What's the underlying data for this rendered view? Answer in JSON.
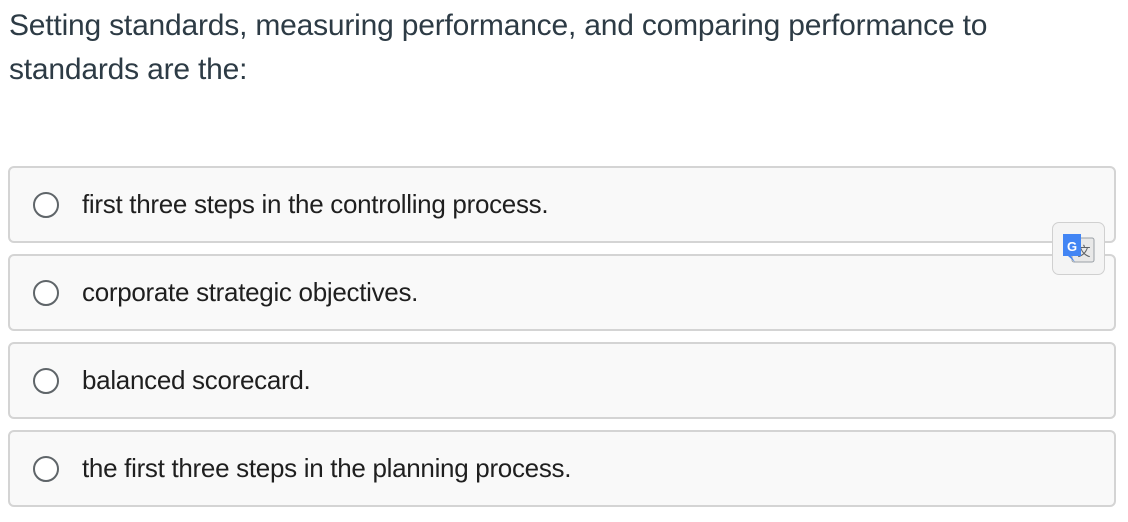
{
  "question": {
    "text": "Setting standards, measuring performance, and comparing performance to standards are the:"
  },
  "answers": [
    {
      "label": "first three steps in the controlling process.",
      "selected": false
    },
    {
      "label": "corporate strategic objectives.",
      "selected": false
    },
    {
      "label": "balanced scorecard.",
      "selected": false
    },
    {
      "label": "the first three steps in the planning process.",
      "selected": false
    }
  ],
  "translate_button": {
    "icon": "google-translate-icon",
    "glyph_g": "G",
    "glyph_wen": "文"
  },
  "colors": {
    "question_text": "#2d3b45",
    "answer_background": "#f9f9f9",
    "answer_border": "#d4d4d4",
    "translate_blue": "#4285f4"
  }
}
